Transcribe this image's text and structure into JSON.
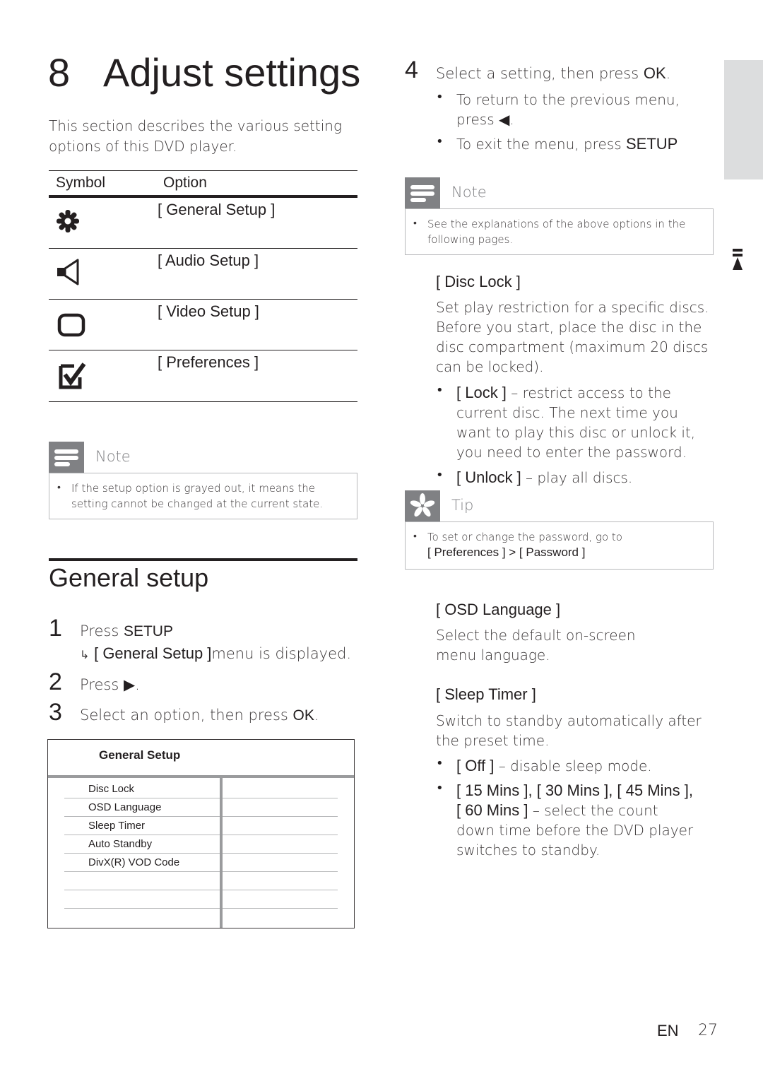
{
  "chapter": {
    "number": "8",
    "title": "Adjust settings"
  },
  "intro": "This section describes the various setting options of this DVD player.",
  "symbol_table": {
    "headers": [
      "Symbol",
      "Option"
    ],
    "rows": [
      {
        "icon": "gear-icon",
        "option": "[ General Setup ]"
      },
      {
        "icon": "speaker-icon",
        "option": "[ Audio Setup ]"
      },
      {
        "icon": "screen-icon",
        "option": "[ Video Setup ]"
      },
      {
        "icon": "checkbox-icon",
        "option": "[ Preferences ]"
      }
    ]
  },
  "note1": {
    "title": "Note",
    "items": [
      "If the setup option is grayed out, it means the setting cannot be changed at the current state."
    ]
  },
  "general_setup": {
    "title": "General setup",
    "steps": [
      {
        "num": "1",
        "pre": "Press ",
        "key": "SETUP",
        "post": ""
      },
      {
        "num": "2",
        "pre": "Press ",
        "key": "▶",
        "post": "."
      },
      {
        "num": "3",
        "pre": "Select an option, then press ",
        "key": "OK",
        "post": "."
      }
    ],
    "step1_result": {
      "arrow": "↳",
      "key": "[ General Setup ]",
      "post": "menu is displayed."
    }
  },
  "menu": {
    "title": "General Setup",
    "items": [
      "Disc Lock",
      "OSD Language",
      "Sleep Timer",
      "Auto Standby",
      "DivX(R) VOD Code",
      "",
      "",
      ""
    ]
  },
  "step4": {
    "num": "4",
    "pre": "Select a setting, then press ",
    "key": "OK",
    "post": ".",
    "bullets": [
      {
        "pre": "To return to the previous menu, press ",
        "key": "◀",
        "post": "."
      },
      {
        "pre": "To exit the menu, press ",
        "key": "SETUP",
        "post": ""
      }
    ]
  },
  "note2": {
    "title": "Note",
    "items": [
      "See the explanations of the above options in the following pages."
    ]
  },
  "disc_lock": {
    "title": "[ Disc Lock ]",
    "body": "Set play restriction for a specific discs. Before you start, place the disc in the disc compartment (maximum 20 discs can be locked).",
    "options": [
      {
        "key": "[ Lock ]",
        "desc": " – restrict access to the current disc. The next time you want to play this disc or unlock it, you need to enter the password."
      },
      {
        "key": "[ Unlock ]",
        "desc": " – play all discs."
      }
    ]
  },
  "tip": {
    "title": "Tip",
    "text": "To set or change the password, go to",
    "path": "[ Preferences ] > [ Password ]"
  },
  "osd_language": {
    "title": "[ OSD Language ]",
    "body": "Select the default on-screen menu language."
  },
  "sleep_timer": {
    "title": "[ Sleep Timer ]",
    "body": "Switch to standby automatically after the preset time.",
    "options": [
      {
        "key": "[ Off ]",
        "desc": " – disable sleep mode."
      },
      {
        "key": "[ 15 Mins ], [ 30 Mins ], [ 45 Mins ], [ 60 Mins ]",
        "desc": " – select the count down time before the DVD player switches to standby."
      }
    ]
  },
  "footer": {
    "lang": "EN",
    "page": "27"
  }
}
